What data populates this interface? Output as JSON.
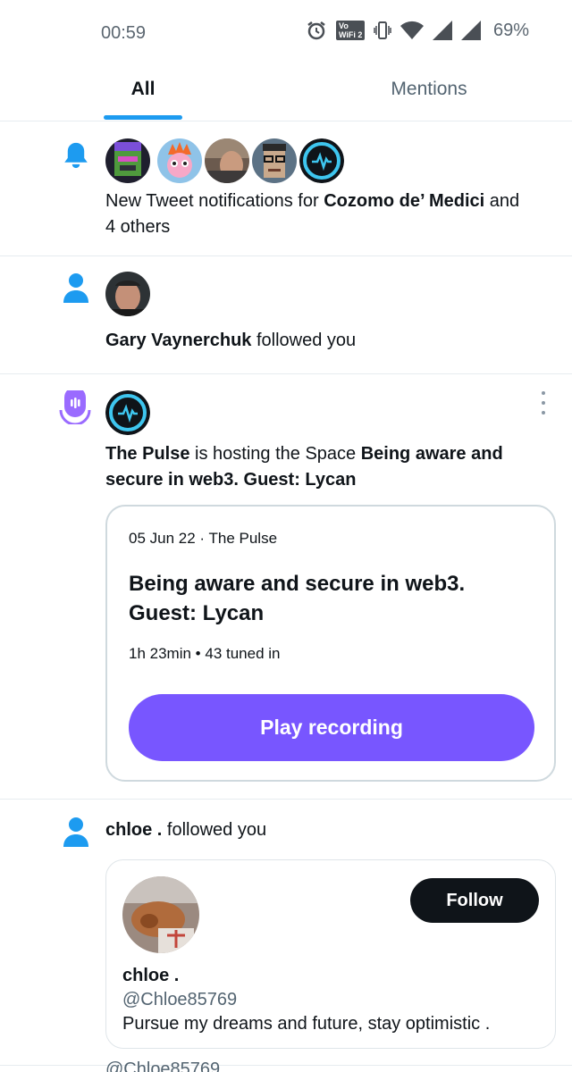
{
  "status_bar": {
    "time": "00:59",
    "battery": "69%",
    "icons": [
      "alarm-icon",
      "vowifi-icon",
      "vibrate-icon",
      "wifi-icon",
      "signal-icon",
      "signal-icon"
    ],
    "vowifi_top": "Vo",
    "vowifi_bottom": "WiFi 2"
  },
  "tabs": [
    {
      "label": "All",
      "selected": true
    },
    {
      "label": "Mentions",
      "selected": false
    }
  ],
  "notifications": [
    {
      "type": "tweet-notifications",
      "icon": "bell-icon",
      "text_prefix": "New Tweet notifications for ",
      "name": "Cozomo de’ Medici",
      "text_suffix_line1": " and",
      "text_line2": "4 others",
      "avatars": [
        "pixel-punk-avatar",
        "flame-cartoon-avatar",
        "portrait-avatar",
        "pixel-punk-glasses-avatar",
        "the-pulse-avatar"
      ]
    },
    {
      "type": "follow",
      "icon": "person-icon",
      "name": "Gary Vaynerchuk",
      "text": " followed you"
    },
    {
      "type": "space",
      "icon": "spaces-icon",
      "host": "The Pulse",
      "text_mid": " is hosting the Space ",
      "space_name_line1": "Being aware and",
      "space_name_line2": "secure in web3. Guest: Lycan",
      "card": {
        "date": "05 Jun 22",
        "host": "The Pulse",
        "title": "Being aware and secure in web3. Guest: Lycan",
        "duration": "1h 23min",
        "tuned_in": "43 tuned in",
        "button": "Play recording"
      }
    },
    {
      "type": "follow",
      "icon": "person-icon",
      "name": "chloe .",
      "text": " followed you",
      "card": {
        "name": "chloe .",
        "handle": "@Chloe85769",
        "bio": "Pursue my dreams and future, stay optimistic .",
        "follow_label": "Follow"
      }
    }
  ],
  "cutoff_handle": "@Chloe85769",
  "colors": {
    "accent": "#1d9bf0",
    "space_purple": "#7856ff",
    "text": "#0f1419",
    "muted": "#536471"
  }
}
